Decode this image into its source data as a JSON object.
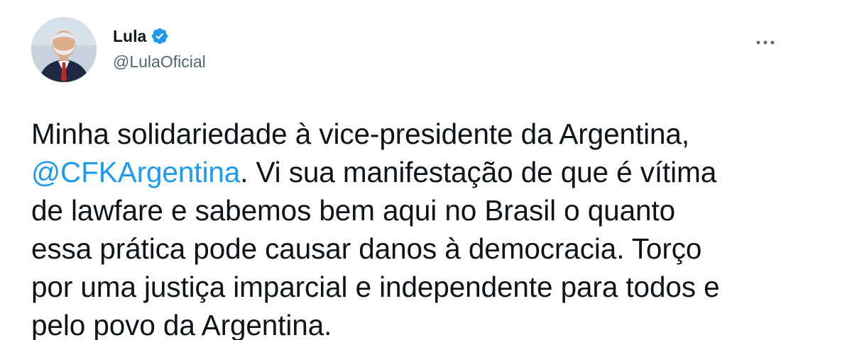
{
  "author": {
    "display_name": "Lula",
    "handle": "@LulaOficial",
    "verified": true
  },
  "tweet": {
    "line1": "Minha solidariedade à vice-presidente da Argentina,",
    "mention": "@CFKArgentina",
    "line2_rest": ". Vi sua manifestação de que é vítima",
    "line3": "de lawfare e sabemos bem aqui no Brasil o quanto",
    "line4": "essa prática pode causar danos à democracia. Torço",
    "line5": "por uma justiça imparcial e independente para todos e",
    "line6": "pelo povo da Argentina."
  },
  "colors": {
    "accent": "#1d9bf0",
    "text": "#0f1419",
    "secondary": "#536471"
  },
  "icons": {
    "verified": "verified-badge-icon",
    "more": "more-options-icon"
  }
}
